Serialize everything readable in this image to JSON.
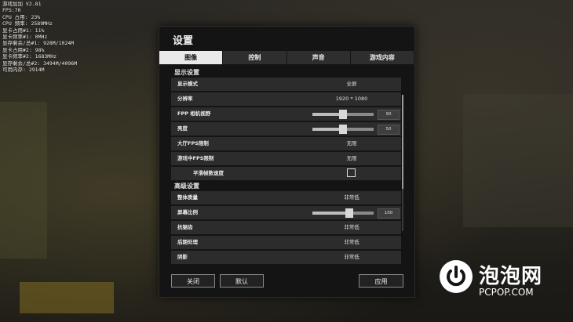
{
  "overlay": {
    "lines": [
      "游戏加加 V2.81",
      "FPS:70",
      "CPU 占用: 23%",
      "CPU 频率: 2589MHz",
      "显卡占用#1: 11%",
      "显卡频率#1: 0MHz",
      "显存剩余/总#1: 928M/1024M",
      "显卡占用#2: 98%",
      "显卡频率#2: 1683MHz",
      "显存剩余/总#2: 3494M/4096M",
      "可用内存: 2914M"
    ]
  },
  "dialog": {
    "title": "设置",
    "tabs": [
      "图像",
      "控制",
      "声音",
      "游戏内容"
    ],
    "active_tab": "图像",
    "sections": {
      "display": "显示设置",
      "advanced": "高级设置"
    },
    "rows": {
      "display_mode": {
        "label": "显示模式",
        "value": "全屏"
      },
      "resolution": {
        "label": "分辨率",
        "value": "1920 * 1080"
      },
      "fpp_fov": {
        "label": "FPP 相机视野",
        "value": "90",
        "level": 0.5
      },
      "brightness": {
        "label": "亮度",
        "value": "50",
        "level": 0.5
      },
      "lobby_fps": {
        "label": "大厅FPS限制",
        "value": "无限"
      },
      "ingame_fps": {
        "label": "游戏中FPS限制",
        "value": "无限"
      },
      "smooth_frame": {
        "label": "平滑帧数速度",
        "checked": false
      },
      "overall_quality": {
        "label": "整体质量",
        "value": "非常低"
      },
      "screen_scale": {
        "label": "屏幕比例",
        "value": "100",
        "level": 0.6
      },
      "anti_aliasing": {
        "label": "抗锯齿",
        "value": "非常低"
      },
      "post_processing": {
        "label": "后期处理",
        "value": "非常低"
      },
      "shadows": {
        "label": "阴影",
        "value": "非常低"
      }
    },
    "buttons": {
      "close": "关闭",
      "default": "默认",
      "apply": "应用"
    }
  },
  "logo": {
    "main": "泡泡网",
    "sub": "PCPOP.COM"
  },
  "colors": {
    "dialog_bg": "#141414",
    "row_bg": "#2c2c2c",
    "active_tab_bg": "#e9e9e9"
  }
}
